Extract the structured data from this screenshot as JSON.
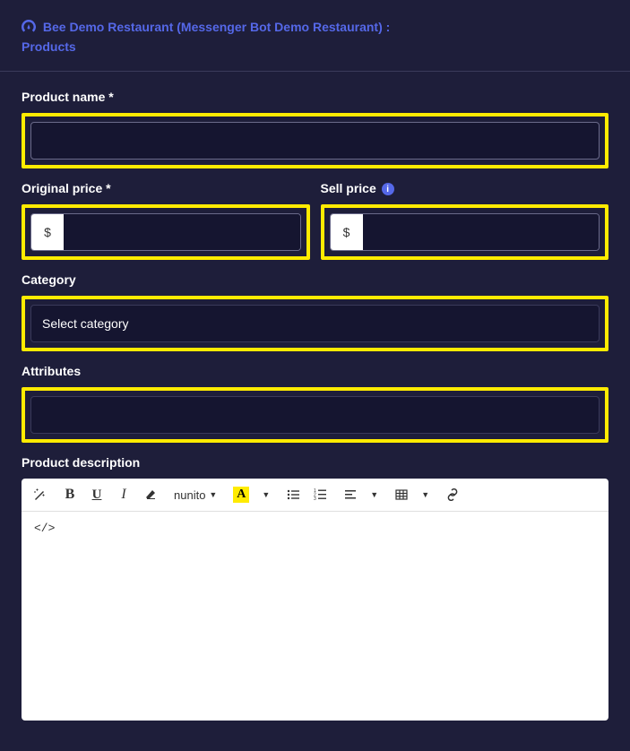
{
  "breadcrumb": {
    "icon": "dashboard-icon",
    "store": "Bee Demo Restaurant (Messenger Bot Demo Restaurant) :",
    "page": "Products"
  },
  "form": {
    "product_name": {
      "label": "Product name *",
      "value": ""
    },
    "original_price": {
      "label": "Original price *",
      "prefix": "$",
      "value": ""
    },
    "sell_price": {
      "label": "Sell price",
      "prefix": "$",
      "value": ""
    },
    "category": {
      "label": "Category",
      "placeholder": "Select category"
    },
    "attributes": {
      "label": "Attributes",
      "value": ""
    },
    "description": {
      "label": "Product description"
    }
  },
  "editor": {
    "buttons": {
      "bold": "B",
      "underline": "U",
      "italic": "I",
      "font_name": "nunito",
      "color": "A"
    },
    "content": "</>"
  }
}
